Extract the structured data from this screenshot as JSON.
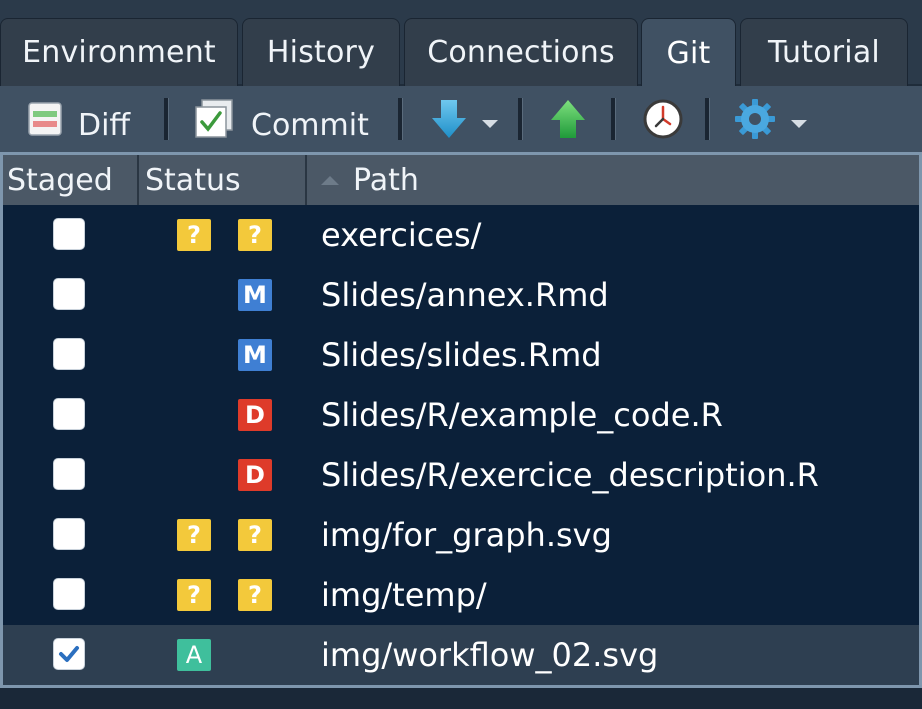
{
  "tabs": [
    {
      "label": "Environment",
      "active": false
    },
    {
      "label": "History",
      "active": false
    },
    {
      "label": "Connections",
      "active": false
    },
    {
      "label": "Git",
      "active": true
    },
    {
      "label": "Tutorial",
      "active": false
    }
  ],
  "toolbar": {
    "diff_label": "Diff",
    "commit_label": "Commit",
    "icons": [
      "diff-icon",
      "commit-icon",
      "pull-arrow-down-icon",
      "push-arrow-up-icon",
      "history-clock-icon",
      "gear-icon"
    ]
  },
  "table": {
    "columns": {
      "staged": "Staged",
      "status": "Status",
      "path": "Path"
    },
    "rows": [
      {
        "staged": false,
        "index": "?",
        "worktree": "?",
        "path": "exercices/"
      },
      {
        "staged": false,
        "index": "",
        "worktree": "M",
        "path": "Slides/annex.Rmd"
      },
      {
        "staged": false,
        "index": "",
        "worktree": "M",
        "path": "Slides/slides.Rmd"
      },
      {
        "staged": false,
        "index": "",
        "worktree": "D",
        "path": "Slides/R/example_code.R"
      },
      {
        "staged": false,
        "index": "",
        "worktree": "D",
        "path": "Slides/R/exercice_description.R"
      },
      {
        "staged": false,
        "index": "?",
        "worktree": "?",
        "path": "img/for_graph.svg"
      },
      {
        "staged": false,
        "index": "?",
        "worktree": "?",
        "path": "img/temp/"
      },
      {
        "staged": true,
        "index": "A",
        "worktree": "",
        "path": "img/workflow_02.svg",
        "selected": true
      }
    ]
  },
  "colors": {
    "untracked": "#f3c93b",
    "modified": "#3f7fd3",
    "deleted": "#de3b2a",
    "added": "#3fbf9c",
    "table_bg": "#0b2039",
    "selected_row": "#2e3f51",
    "toolbar_bg": "#405163"
  }
}
